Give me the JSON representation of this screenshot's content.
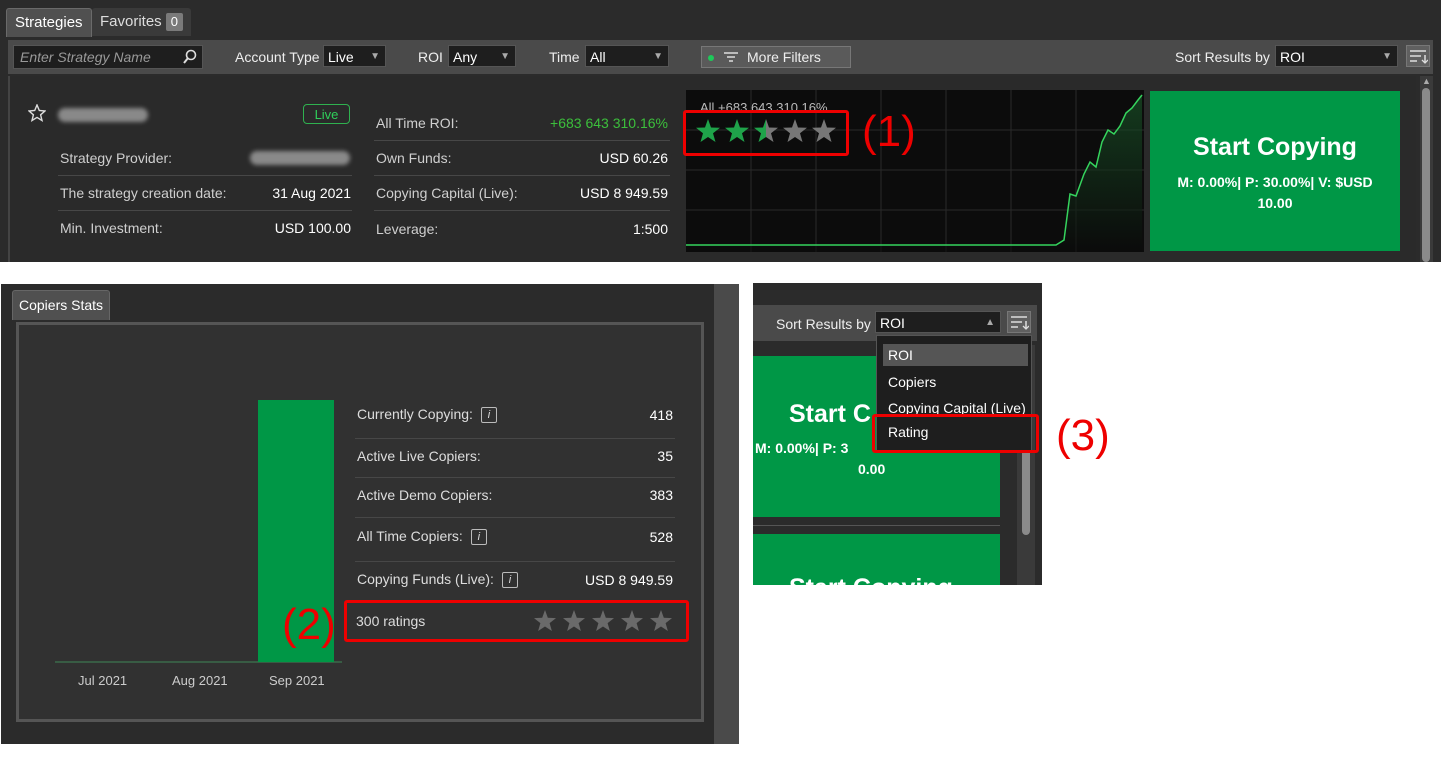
{
  "top": {
    "tabs": [
      {
        "label": "Strategies"
      },
      {
        "label": "Favorites",
        "badge": "0"
      }
    ],
    "filters": {
      "search_placeholder": "Enter Strategy Name",
      "account_type_label": "Account Type",
      "account_type_value": "Live",
      "roi_label": "ROI",
      "roi_value": "Any",
      "time_label": "Time",
      "time_value": "All",
      "more_filters_label": "More Filters",
      "sort_label": "Sort Results by",
      "sort_value": "ROI"
    },
    "card": {
      "live_badge": "Live",
      "rows_left": [
        {
          "label": "Strategy Provider:",
          "value": ""
        },
        {
          "label": "The strategy creation date:",
          "value": "31 Aug 2021"
        },
        {
          "label": "Min. Investment:",
          "value": "USD 100.00"
        }
      ],
      "all_time_roi_label": "All Time ROI:",
      "all_time_roi_value": "+683 643 310.16%",
      "rows_mid": [
        {
          "label": "Own Funds:",
          "value": "USD 60.26"
        },
        {
          "label": "Copying Capital (Live):",
          "value": "USD 8 949.59"
        },
        {
          "label": "Leverage:",
          "value": "1:500"
        }
      ],
      "chart_overlay_text": "All +683 643 310.16%",
      "rating_stars": 2.5,
      "start_copying_title": "Start Copying",
      "fee_line1": "M: 0.00%| P: 30.00%| V: $USD",
      "fee_line2": "10.00"
    },
    "callout": "(1)"
  },
  "stats": {
    "tab": "Copiers Stats",
    "x_labels": [
      "Jul 2021",
      "Aug 2021",
      "Sep 2021"
    ],
    "rows": [
      {
        "label": "Currently Copying:",
        "value": "418",
        "info": true
      },
      {
        "label": "Active Live Copiers:",
        "value": "35",
        "info": false
      },
      {
        "label": "Active Demo Copiers:",
        "value": "383",
        "info": false
      },
      {
        "label": "All Time Copiers:",
        "value": "528",
        "info": true
      },
      {
        "label": "Copying Funds (Live):",
        "value": "USD 8 949.59",
        "info": true
      }
    ],
    "info_glyph": "i",
    "ratings_text": "300 ratings",
    "rating_stars": 0,
    "callout": "(2)"
  },
  "dropdown": {
    "sort_label": "Sort Results by",
    "sort_value": "ROI",
    "options": [
      "ROI",
      "Copiers",
      "Copying Capital (Live)",
      "Rating"
    ],
    "start_title_partial": "Start C",
    "fee_line1_partial": "M: 0.00%| P: 3",
    "fee_line2_partial": "0.00",
    "start_title_cut": "Start Copying",
    "callout": "(3)"
  },
  "colors": {
    "accent_green": "#009746",
    "roi_green": "#3cbf3c",
    "callout_red": "#e00000"
  }
}
